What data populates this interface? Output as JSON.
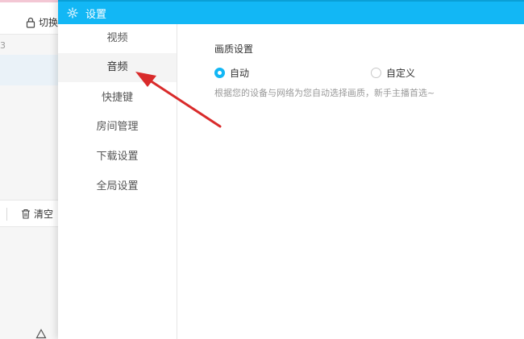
{
  "background_app": {
    "switch_label": "切换",
    "row_number": "3",
    "clear_label": "清空"
  },
  "dialog": {
    "title": "设置",
    "sidebar": {
      "items": [
        {
          "label": "视频"
        },
        {
          "label": "音频"
        },
        {
          "label": "快捷键"
        },
        {
          "label": "房间管理"
        },
        {
          "label": "下载设置"
        },
        {
          "label": "全局设置"
        }
      ],
      "active_index": 1
    },
    "quality": {
      "section_title": "画质设置",
      "options": [
        {
          "label": "自动",
          "checked": true
        },
        {
          "label": "自定义",
          "checked": false
        }
      ],
      "hint": "根据您的设备与网络为您自动选择画质，新手主播首选~"
    }
  },
  "colors": {
    "accent": "#12b7f5",
    "annotation_arrow": "#d92b2b"
  },
  "icons": [
    "lock-icon",
    "trash-icon",
    "gear-icon",
    "triangle-icon"
  ]
}
